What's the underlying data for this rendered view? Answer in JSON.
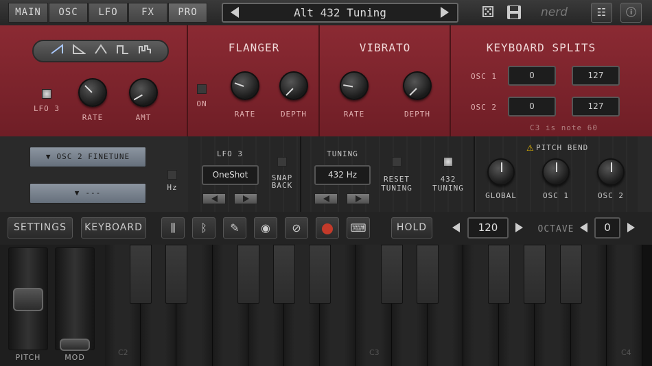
{
  "topbar": {
    "tabs": [
      "MAIN",
      "OSC",
      "LFO",
      "FX",
      "PRO"
    ],
    "active_tab": "PRO",
    "preset_name": "Alt 432 Tuning",
    "brand": "nerd"
  },
  "lfo_section": {
    "waveforms": [
      "saw-up",
      "saw-down",
      "triangle",
      "square",
      "random"
    ],
    "lfo_label": "LFO 3",
    "rate_label": "RATE",
    "amt_label": "AMT"
  },
  "flanger": {
    "title": "FLANGER",
    "on_label": "ON",
    "rate_label": "RATE",
    "depth_label": "DEPTH"
  },
  "vibrato": {
    "title": "VIBRATO",
    "rate_label": "RATE",
    "depth_label": "DEPTH"
  },
  "keyboard_splits": {
    "title": "KEYBOARD SPLITS",
    "osc1_label": "OSC 1",
    "osc1_low": "0",
    "osc1_high": "127",
    "osc2_label": "OSC 2",
    "osc2_low": "0",
    "osc2_high": "127",
    "note": "C3 is note 60"
  },
  "mod_matrix": {
    "dropdown1": "OSC 2 FINETUNE",
    "dropdown2": "---",
    "hz_label": "Hz"
  },
  "lfo3": {
    "title": "LFO 3",
    "mode": "OneShot",
    "snap_back_line1": "SNAP",
    "snap_back_line2": "BACK"
  },
  "tuning": {
    "title": "TUNING",
    "value": "432 Hz",
    "reset_line1": "RESET",
    "reset_line2": "TUNING",
    "t432_line1": "432",
    "t432_line2": "TUNING"
  },
  "pitch_bend": {
    "title": "PITCH BEND",
    "global_label": "GLOBAL",
    "osc1_label": "OSC 1",
    "osc2_label": "OSC 2"
  },
  "toolbar": {
    "settings": "SETTINGS",
    "keyboard": "KEYBOARD",
    "hold": "HOLD",
    "tempo": "120",
    "octave_label": "OCTAVE",
    "octave": "0"
  },
  "wheels": {
    "pitch_label": "PITCH",
    "mod_label": "MOD"
  },
  "keys": {
    "c2": "C2",
    "c3": "C3",
    "c4": "C4"
  },
  "colors": {
    "panel_red": "#8b2a33",
    "accent_blue": "#aac8ff",
    "record_red": "#c43a2a"
  }
}
